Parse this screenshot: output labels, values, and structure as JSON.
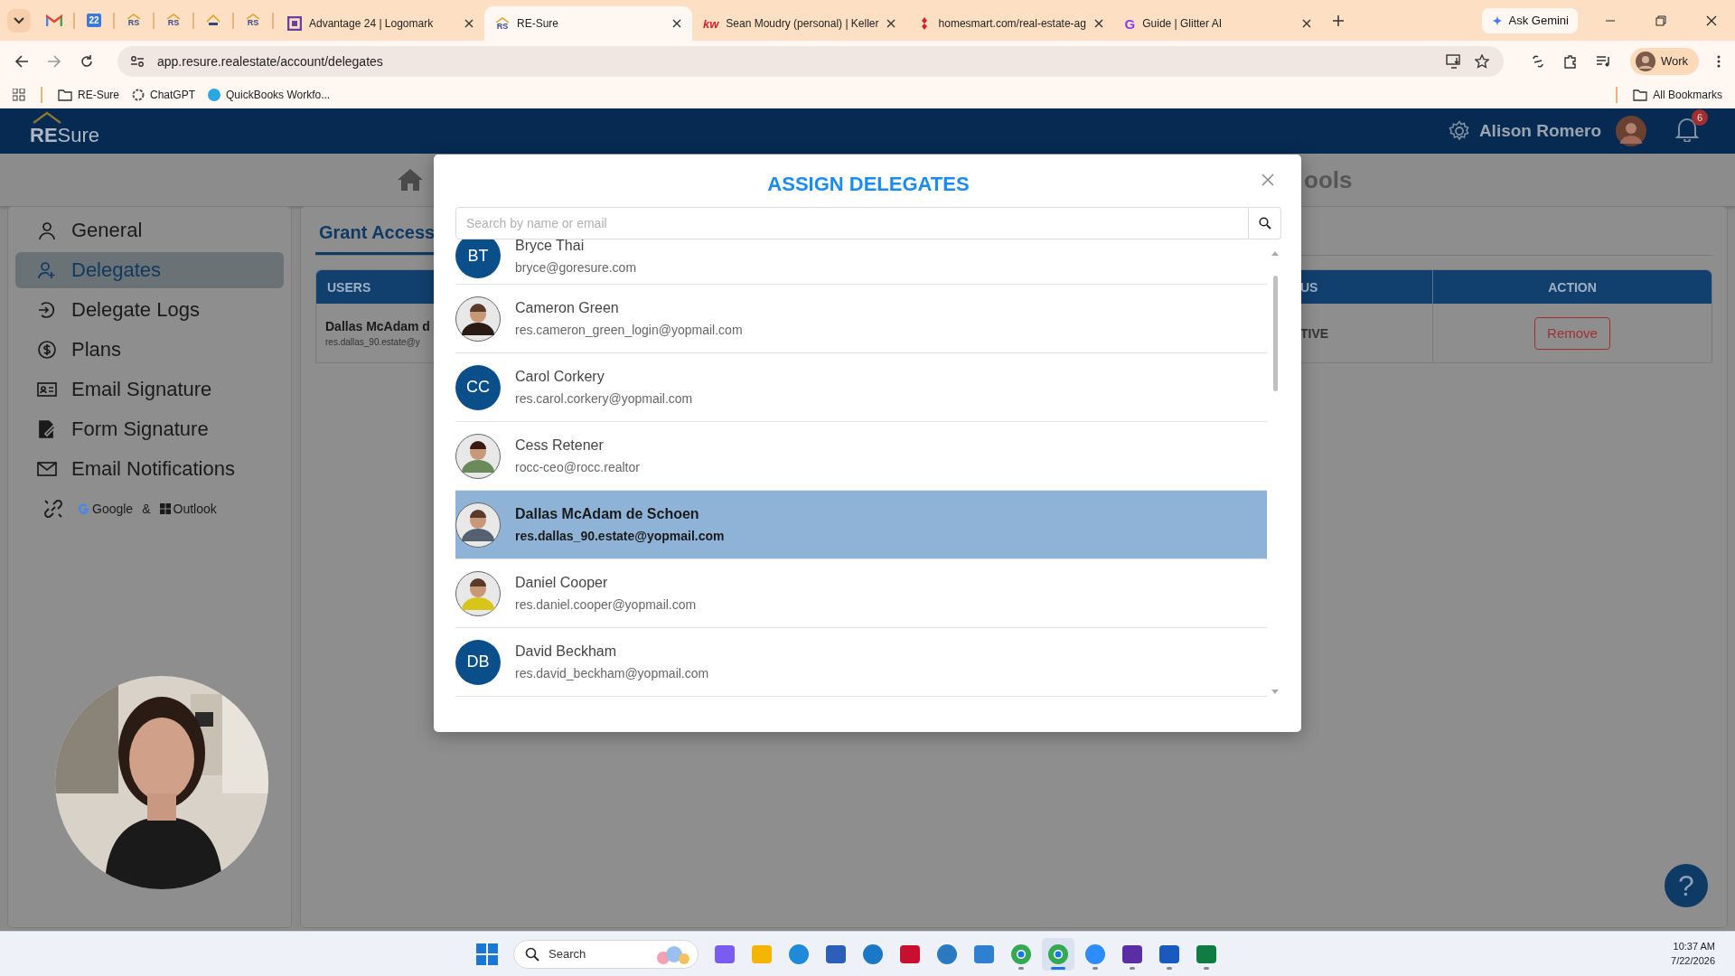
{
  "browser": {
    "pinned_tabs": [
      {
        "kind": "gmail"
      },
      {
        "kind": "calendar",
        "icon_text": "22"
      },
      {
        "kind": "rs",
        "icon_text": "RS"
      },
      {
        "kind": "rs",
        "icon_text": "RS"
      },
      {
        "kind": "house"
      },
      {
        "kind": "rs",
        "icon_text": "RS"
      }
    ],
    "tabs": [
      {
        "label": "Advantage 24 | Logomark",
        "kind": "bracket",
        "selected": false
      },
      {
        "label": "RE-Sure",
        "kind": "rs",
        "icon_text": "RS",
        "selected": true
      },
      {
        "label": "Sean Moudry (personal) | Keller",
        "kind": "kw",
        "icon_text": "kw",
        "selected": false
      },
      {
        "label": "homesmart.com/real-estate-ag",
        "kind": "diamond",
        "selected": false
      },
      {
        "label": "Guide | Glitter AI",
        "kind": "glitter",
        "icon_text": "G",
        "selected": false
      }
    ],
    "gemini": "Ask Gemini",
    "address": "app.resure.realestate/account/delegates",
    "profile": "Work",
    "bookmarks": [
      "RE-Sure",
      "ChatGPT",
      "QuickBooks Workfo..."
    ],
    "all_bookmarks": "All Bookmarks"
  },
  "app": {
    "logo": "RE",
    "logo_suffix": "Sure",
    "user_name": "Alison Romero",
    "notifications": "6",
    "page_title": "ools",
    "sidebar": [
      {
        "label": "General",
        "selected": false
      },
      {
        "label": "Delegates",
        "selected": true
      },
      {
        "label": "Delegate Logs",
        "selected": false
      },
      {
        "label": "Plans",
        "selected": false
      },
      {
        "label": "Email Signature",
        "selected": false
      },
      {
        "label": "Form Signature",
        "selected": false
      },
      {
        "label": "Email Notifications",
        "selected": false
      }
    ],
    "integrations": [
      "Google",
      "&",
      "Outlook"
    ],
    "tab": "Grant Access",
    "table": {
      "columns": [
        "USERS",
        "US",
        "ACTION"
      ],
      "rows": [
        {
          "name": "Dallas McAdam d",
          "email": "res.dallas_90.estate@y",
          "status": "TIVE",
          "action": "Remove"
        }
      ]
    },
    "help": "?"
  },
  "modal": {
    "title": "ASSIGN DELEGATES",
    "search": {
      "placeholder": "Search by name or email"
    },
    "delegates": [
      {
        "name": "Bryce Thai",
        "email": "bryce@goresure.com",
        "kind": "initials",
        "initials": "BT",
        "selected": false
      },
      {
        "name": "Cameron Green",
        "email": "res.cameron_green_login@yopmail.com",
        "selected": false
      },
      {
        "name": "Carol Corkery",
        "email": "res.carol.corkery@yopmail.com",
        "kind": "initials",
        "initials": "CC",
        "selected": false
      },
      {
        "name": "Cess Retener",
        "email": "rocc-ceo@rocc.realtor",
        "selected": false
      },
      {
        "name": "Dallas McAdam de Schoen",
        "email": "res.dallas_90.estate@yopmail.com",
        "selected": true
      },
      {
        "name": "Daniel Cooper",
        "email": "res.daniel.cooper@yopmail.com",
        "selected": false
      },
      {
        "name": "David Beckham",
        "email": "res.david_beckham@yopmail.com",
        "kind": "initials",
        "initials": "DB",
        "selected": false
      }
    ]
  },
  "taskbar": {
    "search": "Search",
    "apps": [
      {
        "kind": "copilot",
        "running": false,
        "selected": false
      },
      {
        "kind": "files",
        "running": false,
        "selected": false
      },
      {
        "kind": "edge",
        "running": false,
        "selected": false
      },
      {
        "kind": "store",
        "running": false,
        "selected": false
      },
      {
        "kind": "help",
        "running": false,
        "selected": false
      },
      {
        "kind": "shield",
        "running": false,
        "selected": false
      },
      {
        "kind": "network",
        "running": false,
        "selected": false
      },
      {
        "kind": "azure",
        "running": false,
        "selected": false
      },
      {
        "kind": "chrome",
        "running": true,
        "selected": false
      },
      {
        "kind": "chrome",
        "running": true,
        "selected": true
      },
      {
        "kind": "zoom",
        "running": true,
        "selected": false
      },
      {
        "kind": "app",
        "running": true,
        "selected": false
      },
      {
        "kind": "word",
        "running": true,
        "selected": false
      },
      {
        "kind": "excel",
        "running": true,
        "selected": false
      }
    ],
    "time": "10:37 AM",
    "date": "7/22/2026"
  }
}
